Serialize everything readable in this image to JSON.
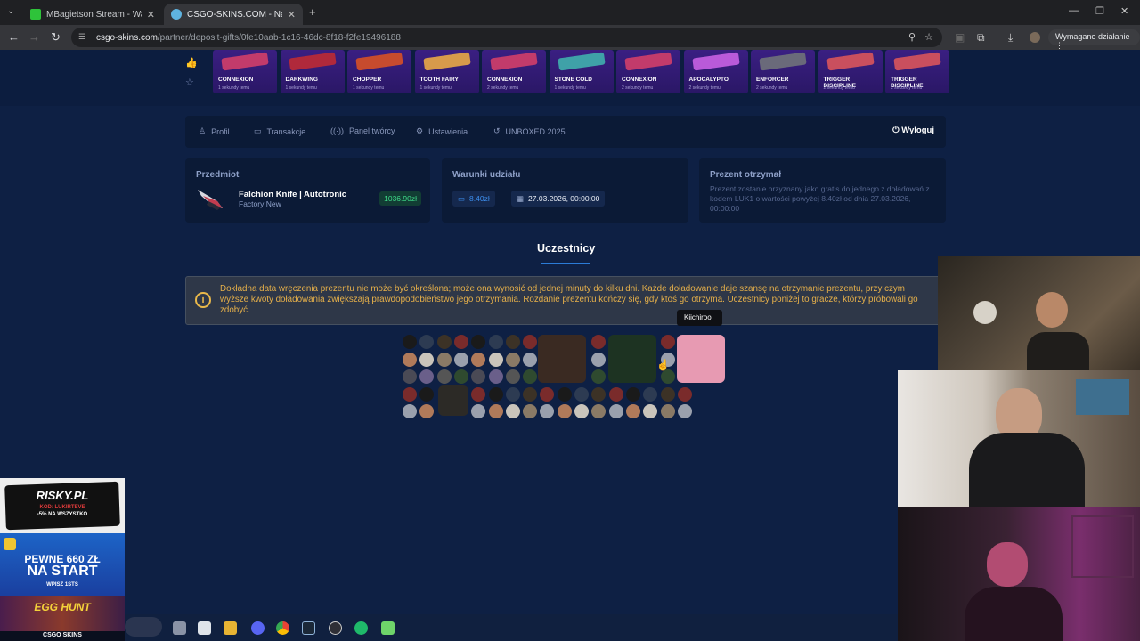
{
  "browser": {
    "tabs": [
      {
        "title": "MBagietson Stream - Watch Live",
        "favicon_color": "#2ec33a"
      },
      {
        "title": "CSGO-SKINS.COM - Najlepsze",
        "favicon_color": "#5fb3e0"
      }
    ],
    "url_domain": "csgo-skins.com",
    "url_path": "/partner/deposit-gifts/0fe10aab-1c16-46dc-8f18-f2fe19496188",
    "required_action": "Wymagane działanie"
  },
  "drops": [
    {
      "name": "CONNEXION",
      "time": "1 sekundy temu",
      "color": "#c23b6b"
    },
    {
      "name": "DARKWING",
      "time": "1 sekundy temu",
      "color": "#b0293b"
    },
    {
      "name": "CHOPPER",
      "time": "1 sekundy temu",
      "color": "#c74b2e"
    },
    {
      "name": "TOOTH FAIRY",
      "time": "1 sekundy temu",
      "color": "#d79a4b"
    },
    {
      "name": "CONNEXION",
      "time": "2 sekundy temu",
      "color": "#c23b6b"
    },
    {
      "name": "STONE COLD",
      "time": "1 sekundy temu",
      "color": "#3fa1a8"
    },
    {
      "name": "CONNEXION",
      "time": "2 sekundy temu",
      "color": "#c23b6b"
    },
    {
      "name": "APOCALYPTO",
      "time": "2 sekundy temu",
      "color": "#b95ad9"
    },
    {
      "name": "ENFORCER",
      "time": "2 sekundy temu",
      "color": "#6a6a7a"
    },
    {
      "name": "TRIGGER DISCIPLINE",
      "time": "2 sekundy temu",
      "color": "#c94f5e"
    },
    {
      "name": "TRIGGER DISCIPLINE",
      "time": "2 sekundy temu",
      "color": "#c94f5e"
    }
  ],
  "menu": {
    "items": [
      {
        "label": "Profil",
        "icon": "user-icon"
      },
      {
        "label": "Transakcje",
        "icon": "card-icon"
      },
      {
        "label": "Panel twórcy",
        "icon": "broadcast-icon"
      },
      {
        "label": "Ustawienia",
        "icon": "gear-icon"
      },
      {
        "label": "UNBOXED 2025",
        "icon": "history-icon"
      }
    ],
    "logout": "Wyloguj"
  },
  "item_card": {
    "title": "Przedmiot",
    "name": "Falchion Knife | Autotronic",
    "condition": "Factory New",
    "price": "1036.90zł"
  },
  "conditions_card": {
    "title": "Warunki udziału",
    "amount": "8.40zł",
    "date": "27.03.2026, 00:00:00"
  },
  "gift_card": {
    "title": "Prezent otrzymał",
    "text": "Prezent zostanie przyznany jako gratis do jednego z doładowań z kodem LUK1 o wartości powyżej 8.40zł od dnia 27.03.2026, 00:00:00"
  },
  "participants": {
    "tab": "Uczestnicy",
    "notice": "Dokładna data wręczenia prezentu nie może być określona; może ona wynosić od jednej minuty do kilku dni. Każde doładowanie daje szansę na otrzymanie prezentu, przy czym wyższe kwoty doładowania zwiększają prawdopodobieństwo jego otrzymania. Rozdanie prezentu kończy się, gdy ktoś go otrzyma. Uczestnicy poniżej to gracze, którzy próbowali go zdobyć.",
    "tooltip": "Kiichiroo_"
  },
  "overlay": {
    "ad1_brand": "RISKY.PL",
    "ad1_code": "KOD: LUKIRTEVE",
    "ad1_promo": "-5% NA WSZYSTKO",
    "ad2_line1": "PEWNE 660 ZŁ",
    "ad2_line2": "NA START",
    "ad2_code": "WPISZ 1STS",
    "ad3": "EGG HUNT",
    "footer_brand": "CSGO SKINS"
  }
}
